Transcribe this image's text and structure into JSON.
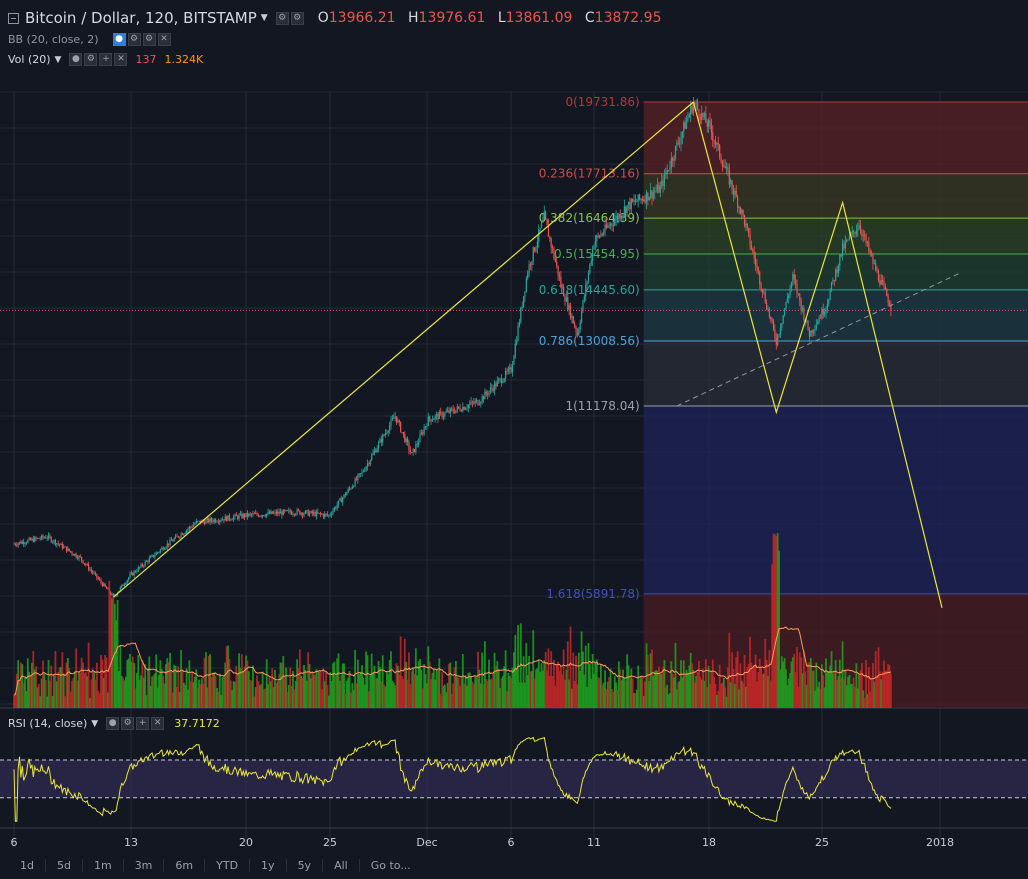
{
  "header": {
    "title": "Bitcoin / Dollar, 120, BITSTAMP",
    "ohlc": [
      {
        "key": "O",
        "value": "13966.21"
      },
      {
        "key": "H",
        "value": "13976.61"
      },
      {
        "key": "L",
        "value": "13861.09"
      },
      {
        "key": "C",
        "value": "13872.95"
      }
    ]
  },
  "indicators": {
    "bb": {
      "label": "BB (20, close, 2)"
    },
    "vol": {
      "label": "Vol (20)",
      "value1": "137",
      "value2": "1.324K"
    },
    "rsi": {
      "label": "RSI (14, close)",
      "value": "37.7172"
    }
  },
  "timeframes": [
    "1d",
    "5d",
    "1m",
    "3m",
    "6m",
    "YTD",
    "1y",
    "5y",
    "All",
    "Go to..."
  ],
  "colors": {
    "background": "#131722",
    "up": "#26a69a",
    "down": "#ef5350",
    "vol_up": "#1fa21f",
    "vol_down": "#c62828",
    "rsi_line": "#e8e83a",
    "drawing": "#e8e83a"
  },
  "chart_data": {
    "type": "candlestick",
    "symbol": "Bitcoin / Dollar",
    "interval": "120",
    "exchange": "BITSTAMP",
    "x_ticks": [
      "6",
      "13",
      "20",
      "25",
      "Dec",
      "6",
      "11",
      "18",
      "25",
      "2018"
    ],
    "price_path": [
      [
        "Nov 6",
        7300
      ],
      [
        "Nov 8",
        7500
      ],
      [
        "Nov 9",
        7200
      ],
      [
        "Nov 10",
        6900
      ],
      [
        "Nov 12",
        5800
      ],
      [
        "Nov 13",
        6400
      ],
      [
        "Nov 15",
        7200
      ],
      [
        "Nov 17",
        7900
      ],
      [
        "Nov 20",
        8100
      ],
      [
        "Nov 23",
        8200
      ],
      [
        "Nov 25",
        8100
      ],
      [
        "Nov 27",
        9300
      ],
      [
        "Nov 29",
        10900
      ],
      [
        "Nov 30",
        9800
      ],
      [
        "Dec 1",
        10800
      ],
      [
        "Dec 4",
        11300
      ],
      [
        "Dec 6",
        12200
      ],
      [
        "Dec 7",
        15000
      ],
      [
        "Dec 8",
        16500
      ],
      [
        "Dec 9",
        14600
      ],
      [
        "Dec 10",
        13200
      ],
      [
        "Dec 11",
        15800
      ],
      [
        "Dec 13",
        16800
      ],
      [
        "Dec 15",
        17300
      ],
      [
        "Dec 17",
        19700
      ],
      [
        "Dec 18",
        19000
      ],
      [
        "Dec 20",
        16500
      ],
      [
        "Dec 22",
        13000
      ],
      [
        "Dec 23",
        14800
      ],
      [
        "Dec 24",
        13200
      ],
      [
        "Dec 25",
        14000
      ],
      [
        "Dec 26",
        15600
      ],
      [
        "Dec 27",
        16300
      ],
      [
        "Dec 28",
        15000
      ],
      [
        "Dec 29",
        13900
      ]
    ],
    "fibonacci": [
      {
        "label": "0(19731.86)",
        "level": 19731.86,
        "color": "#b03a3a"
      },
      {
        "label": "0.236(17713.16)",
        "level": 17713.16,
        "color": "#d04a4a"
      },
      {
        "label": "0.382(16464.39)",
        "level": 16464.39,
        "color": "#8bc34a"
      },
      {
        "label": "0.5(15454.95)",
        "level": 15454.95,
        "color": "#4caf50"
      },
      {
        "label": "0.618(14445.60)",
        "level": 14445.6,
        "color": "#26a69a"
      },
      {
        "label": "0.786(13008.56)",
        "level": 13008.56,
        "color": "#4aa3d8"
      },
      {
        "label": "1(11178.04)",
        "level": 11178.04,
        "color": "#9aa0ac"
      },
      {
        "label": "1.618(5891.78)",
        "level": 5891.78,
        "color": "#3f51b5"
      }
    ],
    "drawings": {
      "uptrend": [
        [
          "Nov 12",
          5800
        ],
        [
          "Dec 17",
          19731.86
        ]
      ],
      "pattern": [
        [
          "Dec 17",
          19731.86
        ],
        [
          "Dec 22",
          11000
        ],
        [
          "Dec 26",
          16900
        ],
        [
          "Jan 1",
          5500
        ]
      ],
      "support_dashed": [
        [
          "Dec 16",
          11180
        ],
        [
          "Jan 2",
          14900
        ]
      ]
    },
    "rsi": {
      "value": 37.7172,
      "upper": 70,
      "lower": 30
    },
    "volume_last": {
      "value1": "137",
      "value2": "1.324K"
    }
  }
}
